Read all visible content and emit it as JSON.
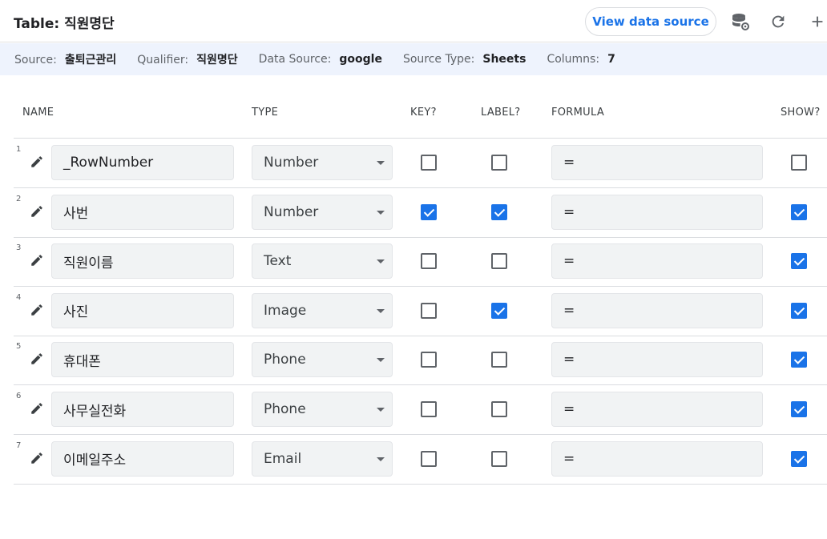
{
  "header": {
    "title": "Table: 직원명단",
    "view_button": "View data source",
    "icons": [
      "database-settings-icon",
      "refresh-icon",
      "add-icon"
    ]
  },
  "info": {
    "source_label": "Source:",
    "source_value": "출퇴근관리",
    "qualifier_label": "Qualifier:",
    "qualifier_value": "직원명단",
    "datasource_label": "Data Source:",
    "datasource_value": "google",
    "sourcetype_label": "Source Type:",
    "sourcetype_value": "Sheets",
    "columns_label": "Columns:",
    "columns_value": "7"
  },
  "columns": {
    "name": "NAME",
    "type": "TYPE",
    "key": "KEY?",
    "label": "LABEL?",
    "formula": "FORMULA",
    "show": "SHOW?"
  },
  "colors": {
    "accent": "#1a73e8",
    "infobar_bg": "#eef3fd"
  },
  "rows": [
    {
      "num": "1",
      "name": "_RowNumber",
      "type": "Number",
      "key": false,
      "label": false,
      "formula": "=",
      "show": false
    },
    {
      "num": "2",
      "name": "사번",
      "type": "Number",
      "key": true,
      "label": true,
      "formula": "=",
      "show": true
    },
    {
      "num": "3",
      "name": "직원이름",
      "type": "Text",
      "key": false,
      "label": false,
      "formula": "=",
      "show": true
    },
    {
      "num": "4",
      "name": "사진",
      "type": "Image",
      "key": false,
      "label": true,
      "formula": "=",
      "show": true
    },
    {
      "num": "5",
      "name": "휴대폰",
      "type": "Phone",
      "key": false,
      "label": false,
      "formula": "=",
      "show": true
    },
    {
      "num": "6",
      "name": "사무실전화",
      "type": "Phone",
      "key": false,
      "label": false,
      "formula": "=",
      "show": true
    },
    {
      "num": "7",
      "name": "이메일주소",
      "type": "Email",
      "key": false,
      "label": false,
      "formula": "=",
      "show": true
    }
  ]
}
